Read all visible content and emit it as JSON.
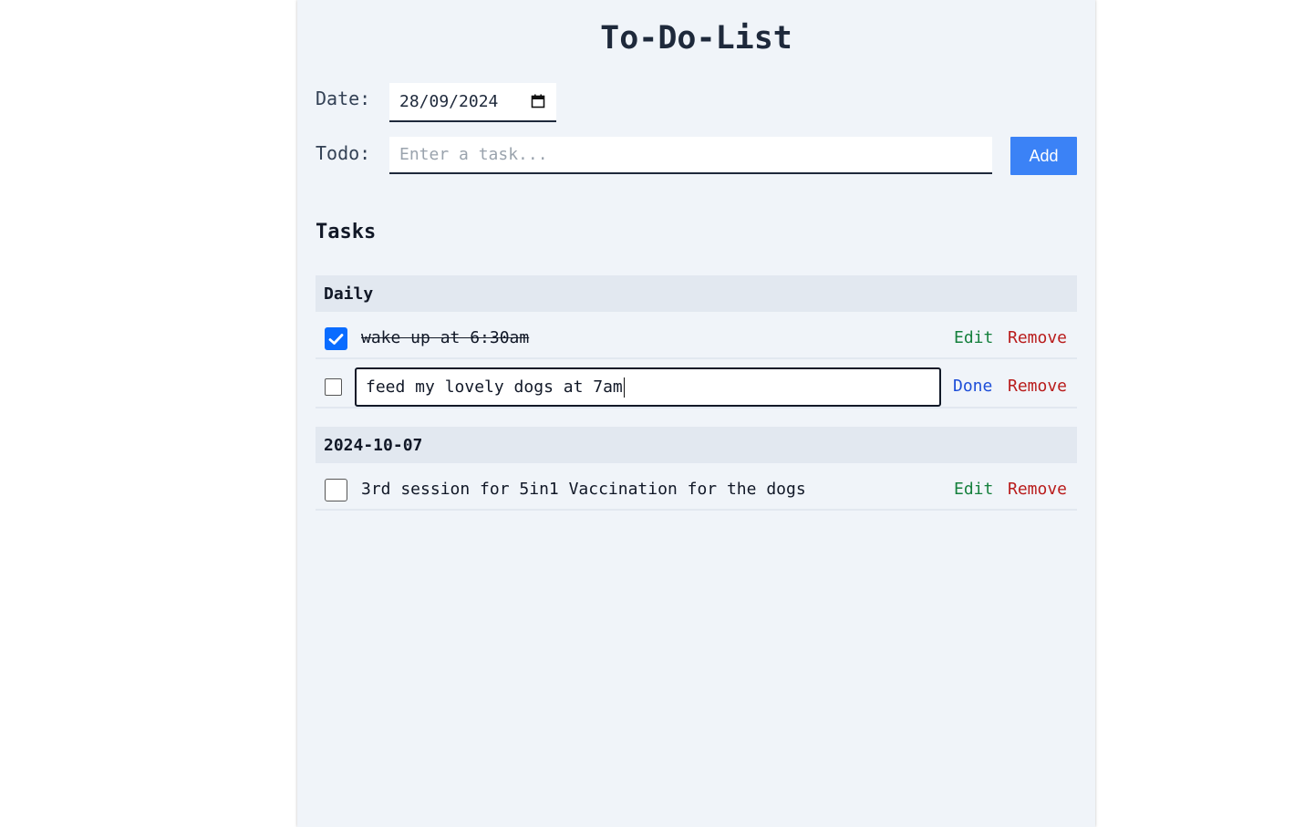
{
  "app": {
    "title": "To-Do-List"
  },
  "form": {
    "date_label": "Date:",
    "date_value": "28/09/2024",
    "todo_label": "Todo:",
    "todo_placeholder": "Enter a task...",
    "add_label": "Add"
  },
  "tasks_heading": "Tasks",
  "groups": [
    {
      "label": "Daily",
      "items": [
        {
          "text": "wake up at 6:30am",
          "checked": true,
          "editing": false,
          "edit_label": "Edit",
          "remove_label": "Remove"
        },
        {
          "text": "feed my lovely dogs at 7am",
          "checked": false,
          "editing": true,
          "done_label": "Done",
          "remove_label": "Remove"
        }
      ]
    },
    {
      "label": "2024-10-07",
      "items": [
        {
          "text": "3rd session for 5in1 Vaccination for the dogs",
          "checked": false,
          "editing": false,
          "edit_label": "Edit",
          "remove_label": "Remove"
        }
      ]
    }
  ],
  "colors": {
    "panel_bg": "#f0f4f9",
    "group_header_bg": "#e2e8f0",
    "add_button": "#3b82f6",
    "checkbox_checked": "#0a6cff",
    "edit_action": "#15803d",
    "remove_action": "#b91c1c",
    "done_action": "#1d4ed8"
  },
  "icons": {
    "date_picker": "calendar-icon",
    "checked_box": "checkmark-icon"
  }
}
